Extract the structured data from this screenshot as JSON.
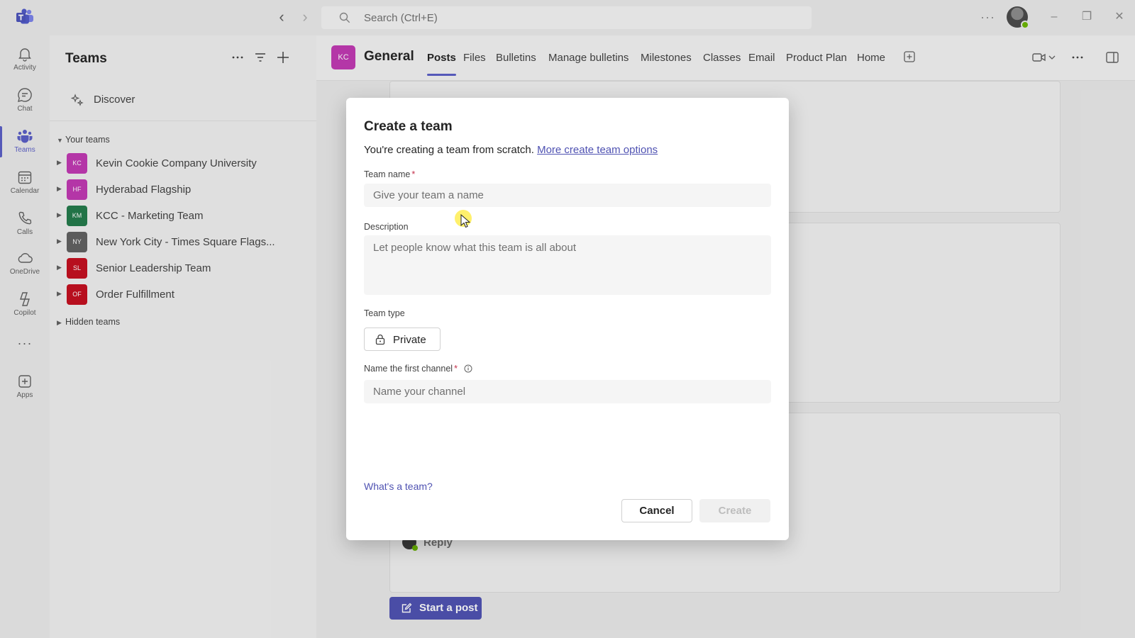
{
  "titlebar": {
    "search_placeholder": "Search (Ctrl+E)",
    "more_label": "···"
  },
  "rail": {
    "items": [
      {
        "label": "Activity"
      },
      {
        "label": "Chat"
      },
      {
        "label": "Teams"
      },
      {
        "label": "Calendar"
      },
      {
        "label": "Calls"
      },
      {
        "label": "OneDrive"
      },
      {
        "label": "Copilot"
      },
      {
        "label": "Apps"
      }
    ],
    "more_label": "···"
  },
  "teams_pane": {
    "title": "Teams",
    "discover_label": "Discover",
    "your_teams_label": "Your teams",
    "hidden_teams_label": "Hidden teams",
    "teams": [
      {
        "initials": "KC",
        "name": "Kevin Cookie Company University",
        "color": "#c239b3"
      },
      {
        "initials": "HF",
        "name": "Hyderabad Flagship",
        "color": "#c239b3"
      },
      {
        "initials": "KM",
        "name": "KCC - Marketing Team",
        "color": "#237b4b"
      },
      {
        "initials": "NY",
        "name": "New York City - Times Square Flags...",
        "color": "#616161"
      },
      {
        "initials": "SL",
        "name": "Senior Leadership Team",
        "color": "#c50f1f"
      },
      {
        "initials": "OF",
        "name": "Order Fulfillment",
        "color": "#c50f1f"
      }
    ]
  },
  "channel": {
    "team_initials": "KC",
    "name": "General",
    "tabs": [
      "Posts",
      "Files",
      "Bulletins",
      "Manage bulletins",
      "Milestones",
      "Classes",
      "Email",
      "Product Plan",
      "Home"
    ],
    "active_tab": "Posts",
    "reply_label": "Reply",
    "start_post_label": "Start a post"
  },
  "dialog": {
    "title": "Create a team",
    "subtitle": "You're creating a team from scratch.",
    "subtitle_link": "More create team options",
    "team_name_label": "Team name",
    "team_name_placeholder": "Give your team a name",
    "required_mark": "*",
    "description_label": "Description",
    "description_placeholder": "Let people know what this team is all about",
    "team_type_label": "Team type",
    "team_type_value": "Private",
    "first_channel_label": "Name the first channel",
    "first_channel_placeholder": "Name your channel",
    "whats_team_link": "What's a team?",
    "cancel_label": "Cancel",
    "create_label": "Create"
  },
  "colors": {
    "accent": "#5b5fc7",
    "brand_dark": "#4f52b2",
    "required": "#c4314b",
    "presence": "#6bb700"
  }
}
